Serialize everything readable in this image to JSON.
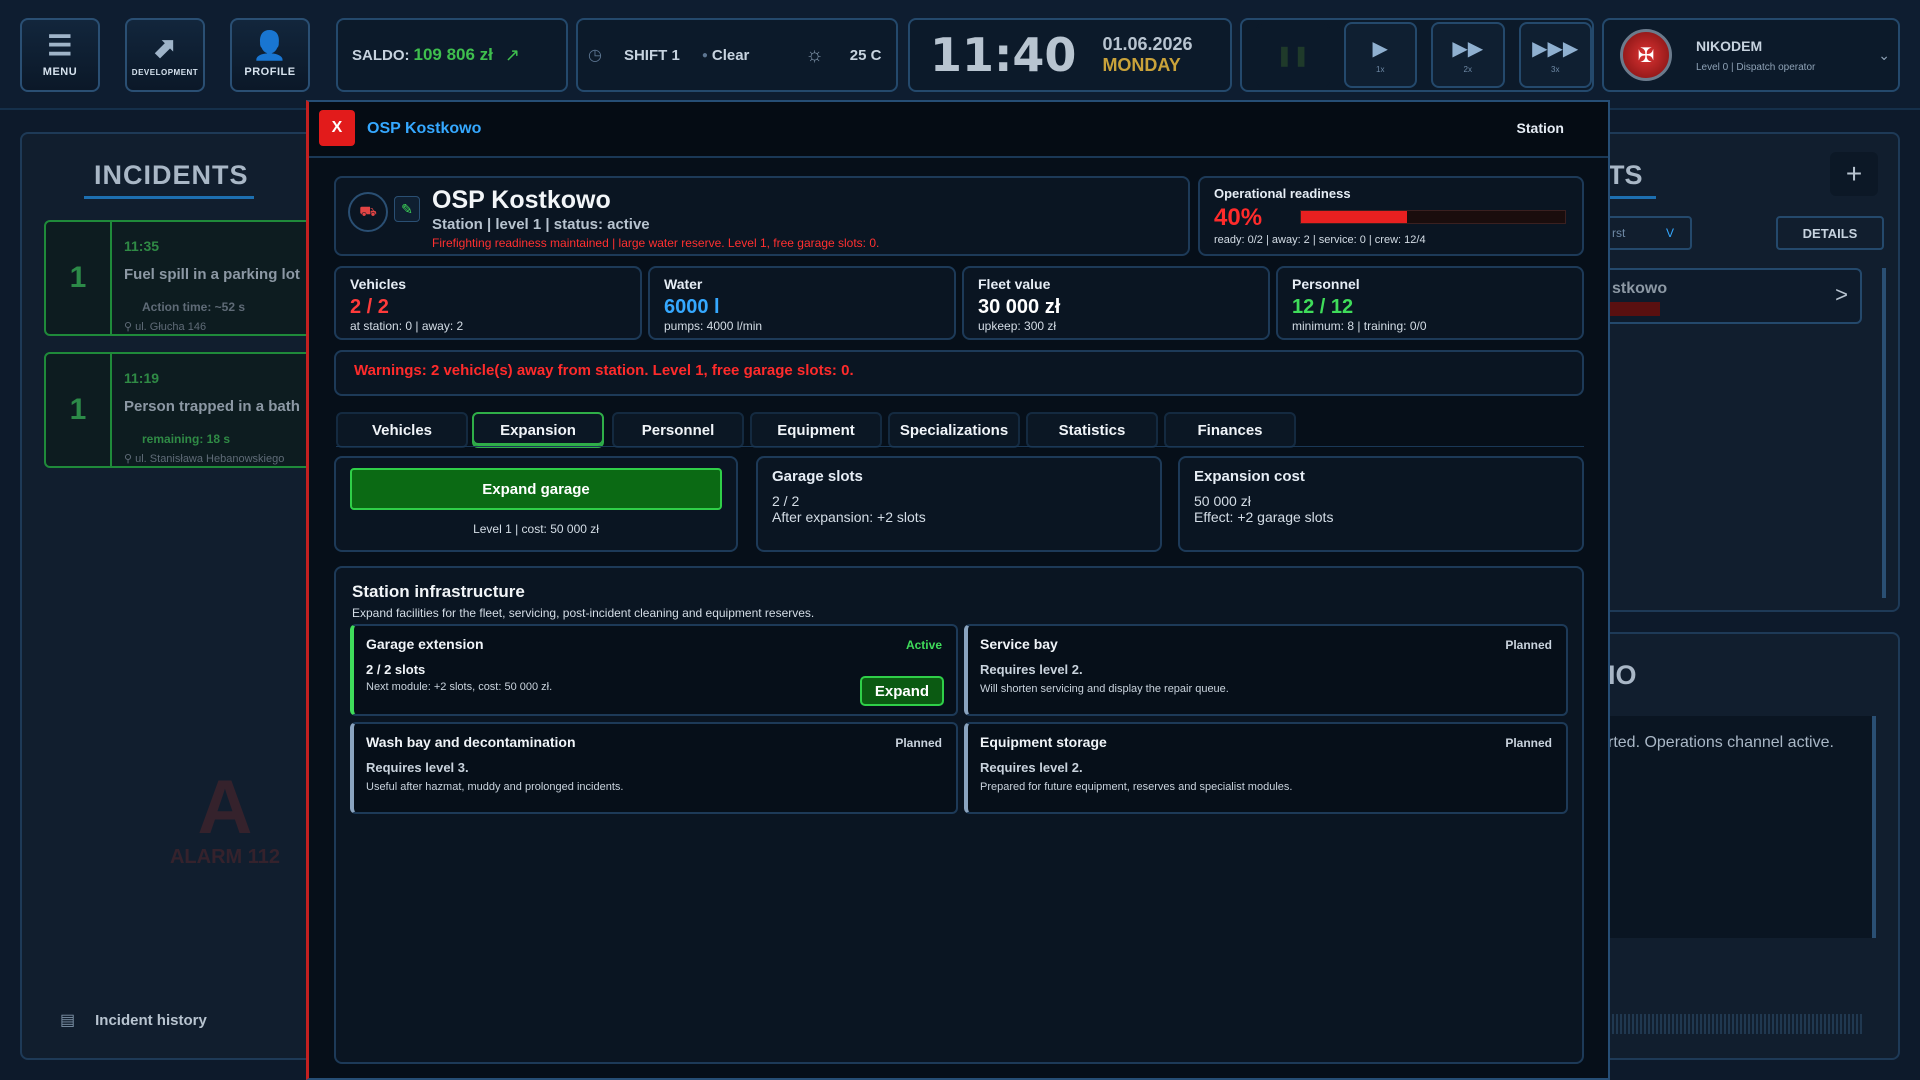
{
  "header": {
    "menu_label": "MENU",
    "development_label": "DEVELOPMENT",
    "profile_label": "PROFILE",
    "balance_label": "SALDO:",
    "balance_value": "109 806 zł",
    "shift": "SHIFT 1",
    "weather": "Clear",
    "temperature": "25 C",
    "time": "11:40",
    "date": "01.06.2026",
    "weekday": "MONDAY",
    "speed_1": "1x",
    "speed_2": "2x",
    "speed_3": "3x",
    "user_name": "NIKODEM",
    "user_role": "Level 0 | Dispatch operator"
  },
  "incidents": {
    "title": "INCIDENTS",
    "items": [
      {
        "count": "1",
        "time": "11:35",
        "title": "Fuel spill in a parking lot",
        "timer": "Action time: ~52 s",
        "address": "ul. Głucha 146"
      },
      {
        "count": "1",
        "time": "11:19",
        "title": "Person trapped in a bath",
        "timer": "remaining: 18 s",
        "address": "ul. Stanisława Hebanowskiego"
      }
    ],
    "history_label": "Incident history",
    "logo_text": "ALARM 112"
  },
  "right_bg": {
    "title": "TS",
    "filter": "rst",
    "filter_chev": "V",
    "details": "DETAILS",
    "station_item": "stkowo",
    "radio_title": "IO",
    "radio_text": "rted. Operations channel active.",
    "plus": "+",
    "arrow": ">"
  },
  "modal": {
    "close": "X",
    "title": "OSP Kostkowo",
    "type": "Station",
    "station_name": "OSP Kostkowo",
    "station_meta": "Station | level 1 | status: active",
    "station_note": "Firefighting readiness maintained | large water reserve. Level 1, free garage slots: 0.",
    "readiness": {
      "label": "Operational readiness",
      "value": "40%",
      "percent": 40,
      "detail": "ready: 0/2 | away: 2 | service: 0 | crew: 12/4"
    },
    "stats": [
      {
        "label": "Vehicles",
        "value": "2 / 2",
        "sub": "at station: 0 | away: 2",
        "color": "#ff3b3b"
      },
      {
        "label": "Water",
        "value": "6000 l",
        "sub": "pumps: 4000 l/min",
        "color": "#35a8ff"
      },
      {
        "label": "Fleet value",
        "value": "30 000 zł",
        "sub": "upkeep: 300 zł",
        "color": "#ffffff"
      },
      {
        "label": "Personnel",
        "value": "12 / 12",
        "sub": "minimum: 8 | training: 0/0",
        "color": "#3fdc5a"
      }
    ],
    "warning": "Warnings: 2 vehicle(s) away from station. Level 1, free garage slots: 0.",
    "tabs": [
      "Vehicles",
      "Expansion",
      "Personnel",
      "Equipment",
      "Specializations",
      "Statistics",
      "Finances"
    ],
    "active_tab": 1,
    "expand": {
      "button": "Expand garage",
      "info": "Level 1 | cost: 50 000 zł"
    },
    "garage_slots": {
      "title": "Garage slots",
      "line1": "2 / 2",
      "line2": "After expansion: +2 slots"
    },
    "expansion_cost": {
      "title": "Expansion cost",
      "line1": "50 000 zł",
      "line2": "Effect: +2 garage slots"
    },
    "infra": {
      "title": "Station infrastructure",
      "desc": "Expand facilities for the fleet, servicing, post-incident cleaning and equipment reserves.",
      "items": [
        {
          "title": "Garage extension",
          "status": "Active",
          "req": "2 / 2 slots",
          "desc": "Next module: +2 slots, cost: 50 000 zł.",
          "button": "Expand"
        },
        {
          "title": "Service bay",
          "status": "Planned",
          "req": "Requires level 2.",
          "desc": "Will shorten servicing and display the repair queue."
        },
        {
          "title": "Wash bay and decontamination",
          "status": "Planned",
          "req": "Requires level 3.",
          "desc": "Useful after hazmat, muddy and prolonged incidents."
        },
        {
          "title": "Equipment storage",
          "status": "Planned",
          "req": "Requires level 2.",
          "desc": "Prepared for future equipment, reserves and specialist modules."
        }
      ]
    }
  },
  "colors": {
    "accent": "#1e90ff",
    "green": "#3fdc5a",
    "red": "#ff2b2b",
    "panel": "#0a1522"
  }
}
